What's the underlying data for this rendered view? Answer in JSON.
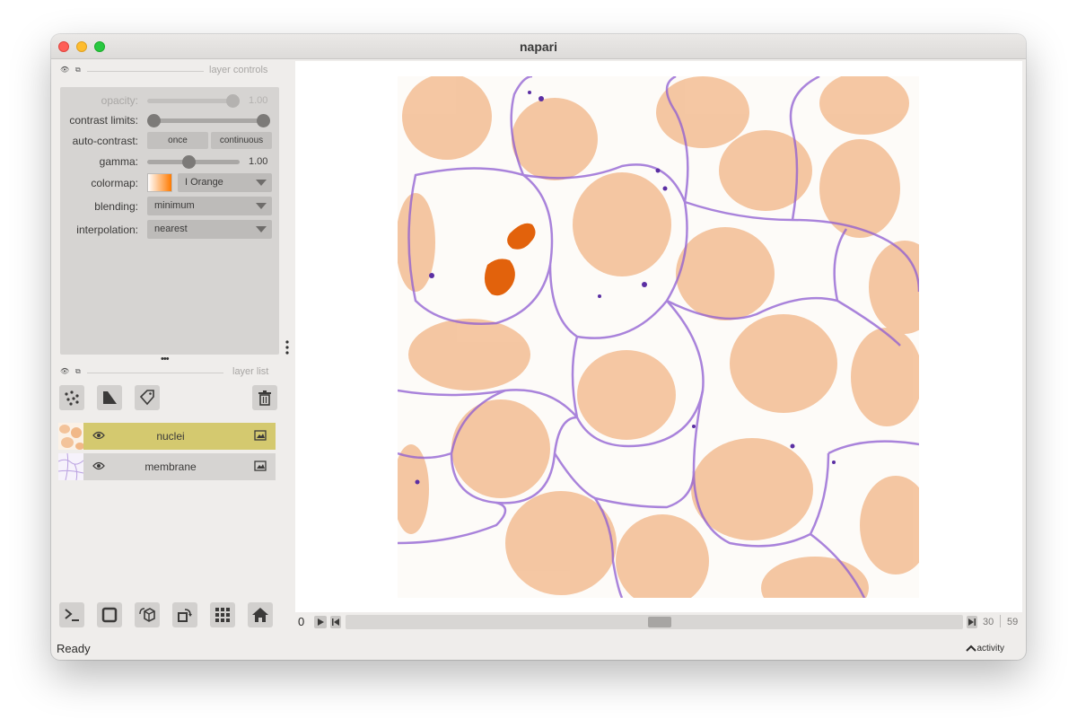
{
  "window": {
    "title": "napari"
  },
  "layer_controls": {
    "header": "layer controls",
    "opacity": {
      "label": "opacity:",
      "value": "1.00",
      "level": 1.0
    },
    "contrast_limits": {
      "label": "contrast limits:",
      "low": 0.0,
      "high": 1.0
    },
    "auto_contrast": {
      "label": "auto-contrast:",
      "once": "once",
      "continuous": "continuous"
    },
    "gamma": {
      "label": "gamma:",
      "value": "1.00",
      "level": 0.5
    },
    "colormap": {
      "label": "colormap:",
      "value": "I Orange"
    },
    "blending": {
      "label": "blending:",
      "value": "minimum"
    },
    "interpolation": {
      "label": "interpolation:",
      "value": "nearest"
    }
  },
  "layer_list": {
    "header": "layer list",
    "layers": [
      {
        "name": "nuclei",
        "selected": true
      },
      {
        "name": "membrane",
        "selected": false
      }
    ]
  },
  "dims": {
    "current": "0",
    "slider_value": "30",
    "max": "59"
  },
  "status": {
    "text": "Ready",
    "activity": "activity"
  },
  "icons": [
    "points-icon",
    "shapes-icon",
    "labels-icon",
    "delete-icon",
    "eye-icon",
    "image-icon",
    "console-icon",
    "square-icon",
    "cube-icon",
    "rotate-icon",
    "grid-icon",
    "home-icon",
    "play-icon"
  ],
  "colors": {
    "selected_layer": "#d4c96f",
    "nuclei": "#f08c3c",
    "membrane": "#7a46c8"
  }
}
